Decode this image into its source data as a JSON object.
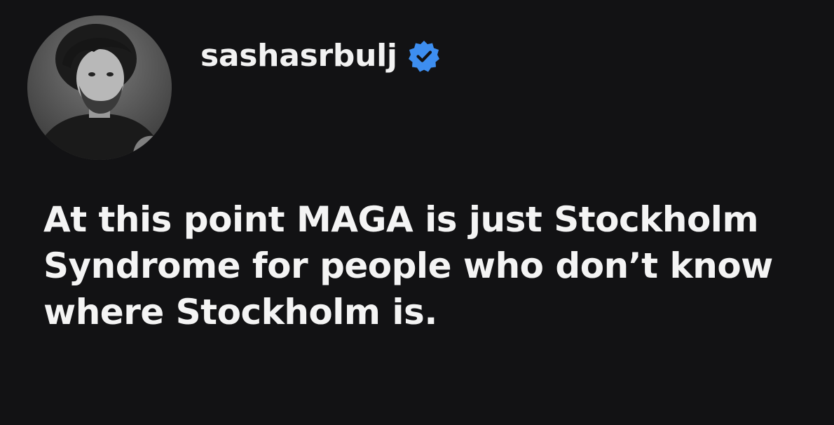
{
  "post": {
    "username": "sashasrbulj",
    "verified": true,
    "verified_icon": "verified-badge-icon",
    "avatar_icon": "profile-photo-grayscale",
    "text_lines": [
      "At this point MAGA is just Stockholm",
      "Syndrome for people who don’t know",
      "where Stockholm is."
    ]
  },
  "colors": {
    "background": "#121214",
    "text": "#f2f2f2",
    "verified_blue": "#3d8ef0"
  }
}
